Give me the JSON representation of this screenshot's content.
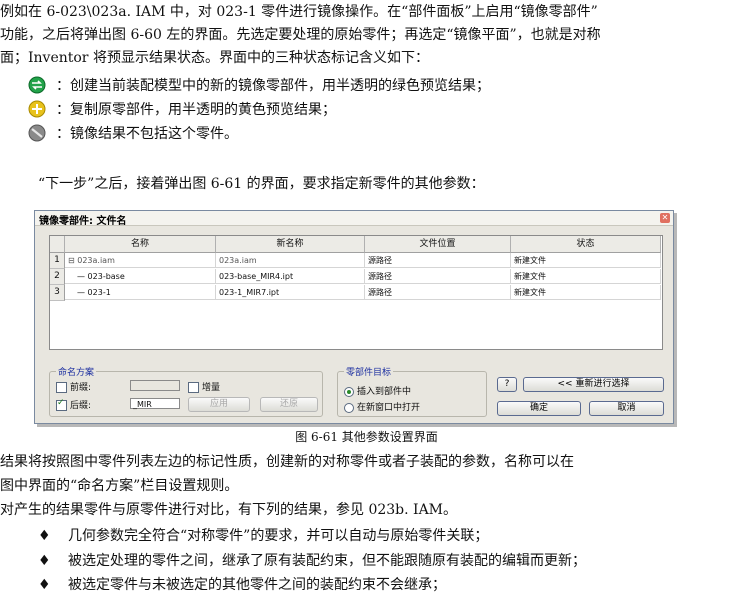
{
  "intro": {
    "line1": "    例如在 6-023\\023a. IAM 中，对 023-1 零件进行镜像操作。在“部件面板”上启用“镜像零部件”",
    "line2": "功能，之后将弹出图 6-60 左的界面。先选定要处理的原始零件；再选定“镜像平面”，也就是对称",
    "line3": "面；Inventor 将预显示结果状态。界面中的三种状态标记含义如下："
  },
  "legend": [
    {
      "icon": "mirror-green-icon",
      "color": "#22a34a",
      "text": "：创建当前装配模型中的新的镜像零部件，用半透明的绿色预览结果；"
    },
    {
      "icon": "reuse-yellow-icon",
      "color": "#e8c21c",
      "text": "：复制原零部件，用半透明的黄色预览结果；"
    },
    {
      "icon": "exclude-gray-icon",
      "color": "#8a8a8a",
      "text": "：镜像结果不包括这个零件。"
    }
  ],
  "next_step": "“下一步”之后，接着弹出图 6-61 的界面，要求指定新零件的其他参数：",
  "dialog": {
    "title": "镜像零部件: 文件名",
    "columns": [
      "名称",
      "新名称",
      "文件位置",
      "状态"
    ],
    "rows": [
      {
        "num": "1",
        "name": "⊟ 023a.iam",
        "new_name": "023a.iam",
        "location": "源路径",
        "status": "新建文件"
      },
      {
        "num": "2",
        "name": "— 023-base",
        "new_name": "023-base_MIR4.ipt",
        "location": "源路径",
        "status": "新建文件"
      },
      {
        "num": "3",
        "name": "— 023-1",
        "new_name": "023-1_MIR7.ipt",
        "location": "源路径",
        "status": "新建文件"
      }
    ],
    "naming": {
      "legend": "命名方案",
      "prefix_label": "前缀:",
      "prefix_checked": false,
      "prefix_value": "",
      "suffix_label": "后缀:",
      "suffix_checked": true,
      "suffix_value": "_MIR",
      "increment_label": "增量",
      "apply_label": "应用",
      "revert_label": "还原"
    },
    "target": {
      "legend": "零部件目标",
      "option1": "插入到部件中",
      "option2": "在新窗口中打开",
      "selected": 1
    },
    "help_label": "?",
    "reselect_label": "<< 重新进行选择",
    "ok_label": "确定",
    "cancel_label": "取消"
  },
  "caption": "图 6-61  其他参数设置界面",
  "body": {
    "p1_line1": "    结果将按照图中零件列表左边的标记性质，创建新的对称零件或者子装配的参数，名称可以在",
    "p1_line2": "图中界面的“命名方案”栏目设置规则。",
    "p2": "    对产生的结果零件与原零件进行对比，有下列的结果，参见 023b. IAM。"
  },
  "bullets": [
    "几何参数完全符合“对称零件”的要求，并可以自动与原始零件关联；",
    "被选定处理的零件之间，继承了原有装配约束，但不能跟随原有装配的编辑而更新；",
    "被选定零件与未被选定的其他零件之间的装配约束不会继承；"
  ]
}
